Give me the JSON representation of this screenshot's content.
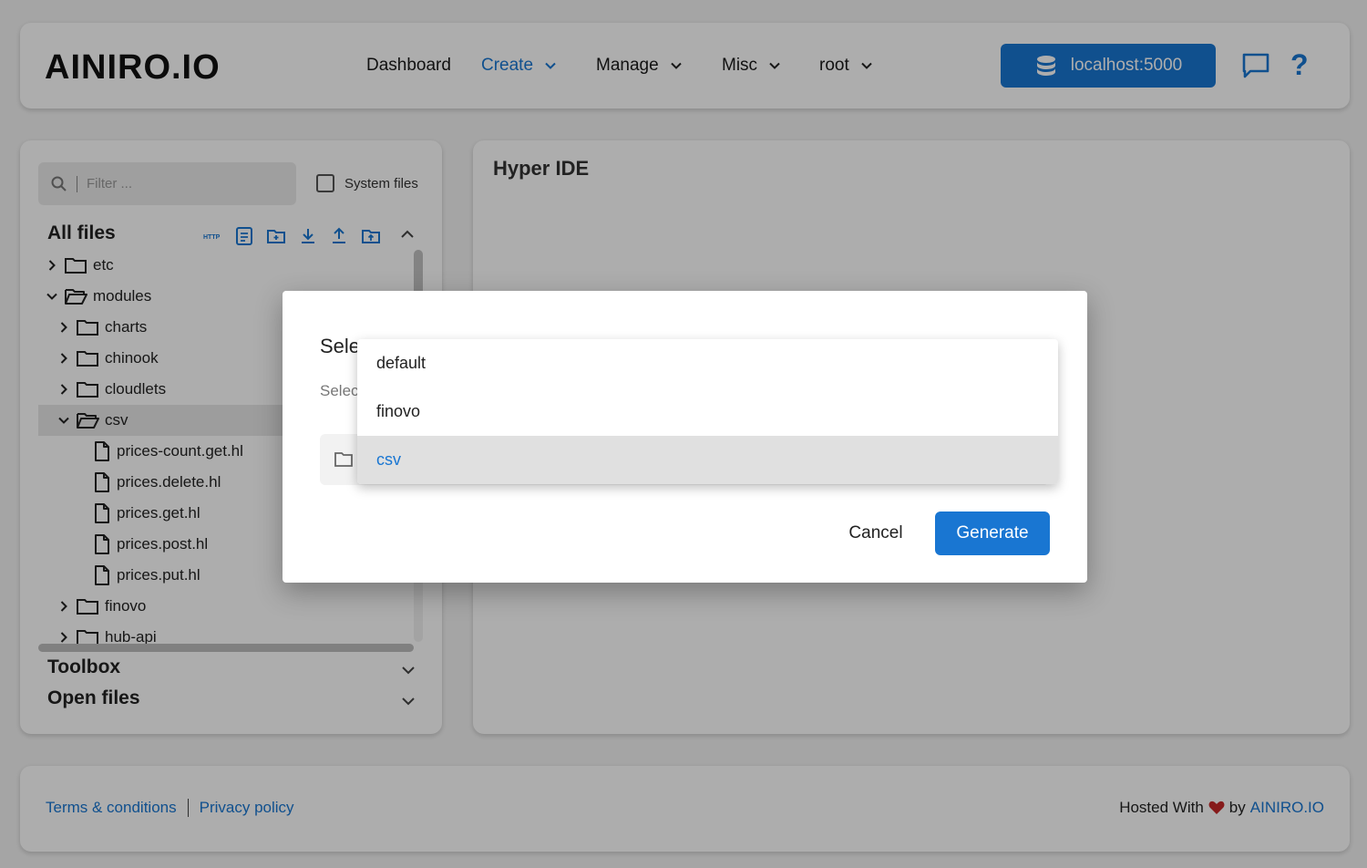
{
  "header": {
    "logo": "AINIRO.IO",
    "nav": [
      {
        "label": "Dashboard",
        "dropdown": false
      },
      {
        "label": "Create",
        "dropdown": true,
        "active": true
      },
      {
        "label": "Manage",
        "dropdown": true
      },
      {
        "label": "Misc",
        "dropdown": true
      },
      {
        "label": "root",
        "dropdown": true
      }
    ],
    "backend_label": "localhost:5000",
    "help_label": "?"
  },
  "sidebar": {
    "filter_placeholder": "Filter ...",
    "system_files_label": "System files",
    "all_files_title": "All files",
    "http_icon_text": "HTTP",
    "tree": [
      {
        "label": "etc",
        "type": "folder",
        "depth": 0,
        "expanded": false
      },
      {
        "label": "modules",
        "type": "folder",
        "depth": 0,
        "expanded": true
      },
      {
        "label": "charts",
        "type": "folder",
        "depth": 1,
        "expanded": false
      },
      {
        "label": "chinook",
        "type": "folder",
        "depth": 1,
        "expanded": false
      },
      {
        "label": "cloudlets",
        "type": "folder",
        "depth": 1,
        "expanded": false
      },
      {
        "label": "csv",
        "type": "folder",
        "depth": 1,
        "expanded": true,
        "selected": true
      },
      {
        "label": "prices-count.get.hl",
        "type": "file",
        "depth": 2
      },
      {
        "label": "prices.delete.hl",
        "type": "file",
        "depth": 2
      },
      {
        "label": "prices.get.hl",
        "type": "file",
        "depth": 2
      },
      {
        "label": "prices.post.hl",
        "type": "file",
        "depth": 2
      },
      {
        "label": "prices.put.hl",
        "type": "file",
        "depth": 2
      },
      {
        "label": "finovo",
        "type": "folder",
        "depth": 1,
        "expanded": false
      },
      {
        "label": "hub-api",
        "type": "folder",
        "depth": 1,
        "expanded": false
      }
    ],
    "toolbox_label": "Toolbox",
    "open_files_label": "Open files"
  },
  "main": {
    "title": "Hyper IDE"
  },
  "dialog": {
    "title_visible": "Sele",
    "subtitle_visible": "Selec",
    "cancel_label": "Cancel",
    "generate_label": "Generate",
    "options": [
      {
        "label": "default",
        "selected": false
      },
      {
        "label": "finovo",
        "selected": false
      },
      {
        "label": "csv",
        "selected": true
      }
    ]
  },
  "footer": {
    "terms_label": "Terms & conditions",
    "privacy_label": "Privacy policy",
    "hosted_prefix": "Hosted With",
    "hosted_by": "by",
    "hosted_link": "AINIRO.IO"
  },
  "colors": {
    "accent": "#1976d2",
    "background": "#f4f4f4",
    "heart": "#c62828"
  }
}
